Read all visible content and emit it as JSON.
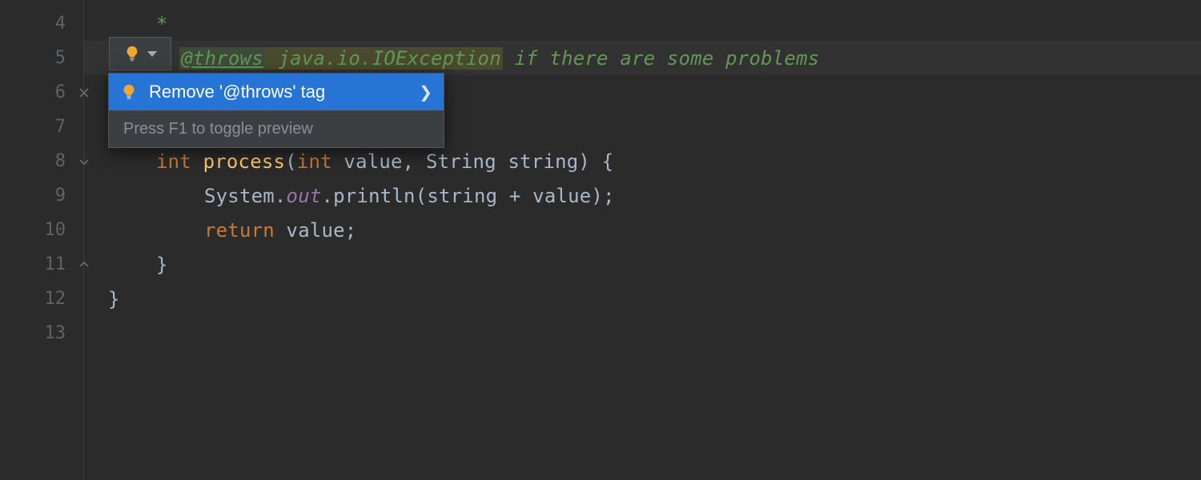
{
  "gutter": {
    "lines": [
      "4",
      "5",
      "6",
      "7",
      "8",
      "9",
      "10",
      "11",
      "12",
      "13"
    ],
    "fold_at": [
      6,
      8,
      11
    ]
  },
  "code": {
    "l4_star": "*",
    "l5_star": "* ",
    "l5_tag": "@throws",
    "l5_type": " java.io.IOException",
    "l5_rest": " if there are some problems",
    "l8_kw1": "int",
    "l8_name": " process",
    "l8_open": "(",
    "l8_kw2": "int",
    "l8_rest": " value, String string) {",
    "l9_a": "System.",
    "l9_out": "out",
    "l9_b": ".println(string + value);",
    "l10_kw": "return",
    "l10_rest": " value;",
    "l11": "}",
    "l12": "}"
  },
  "bulb": {
    "icon": "bulb-icon"
  },
  "popup": {
    "action": "Remove '@throws' tag",
    "hint": "Press F1 to toggle preview"
  }
}
